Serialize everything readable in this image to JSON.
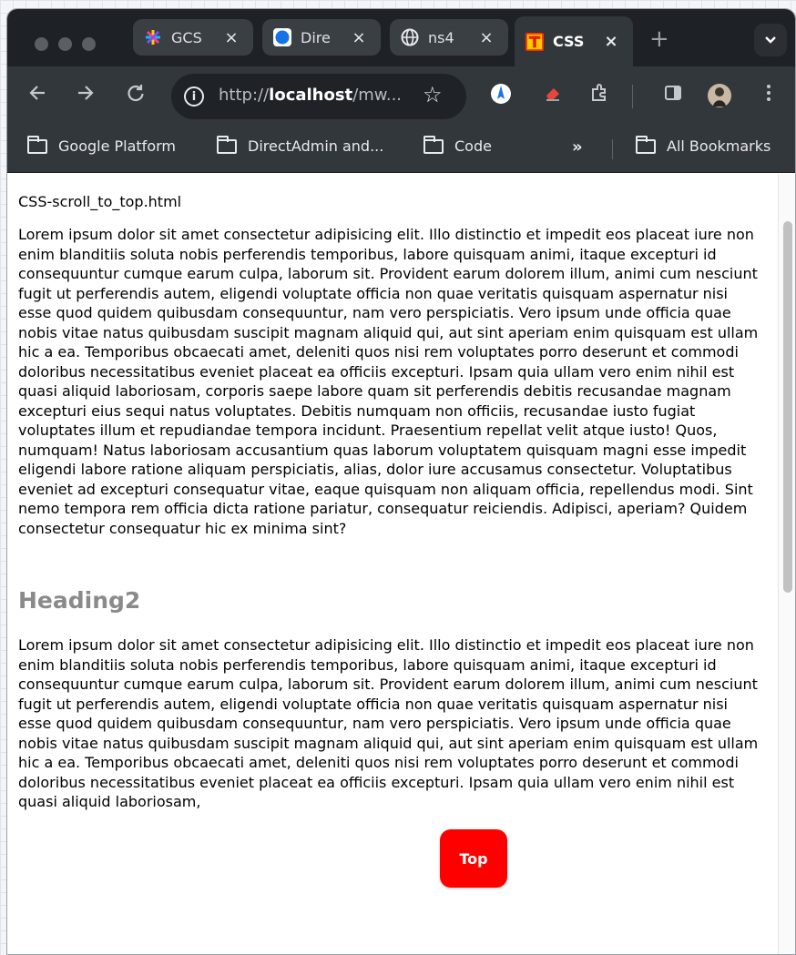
{
  "tabs": [
    {
      "title": "GCS",
      "favicon": "colorful-star-icon"
    },
    {
      "title": "Dire",
      "favicon": "blue-circle-icon"
    },
    {
      "title": "ns4",
      "favicon": "globe-icon"
    },
    {
      "title": "CSS",
      "favicon": "t-letter-icon",
      "active": true
    }
  ],
  "tab_close": "×",
  "new_tab": "+",
  "tab_search": "⌄",
  "address": {
    "prefix": "http://",
    "host": "localhost",
    "path": "/mw..."
  },
  "toolbar_icons": [
    "back-icon",
    "forward-icon",
    "reload-icon",
    "info-icon",
    "star-icon",
    "extension-icon",
    "eraser-icon",
    "puzzle-icon",
    "sidebar-icon",
    "profile-icon",
    "menu-icon"
  ],
  "bookmarks": [
    {
      "label": "Google Platform"
    },
    {
      "label": "DirectAdmin and..."
    },
    {
      "label": "Code"
    }
  ],
  "bookmarks_overflow": "»",
  "all_bookmarks": "All Bookmarks",
  "page": {
    "filename": "CSS-scroll_to_top.html",
    "paragraph1": "Lorem ipsum dolor sit amet consectetur adipisicing elit. Illo distinctio et impedit eos placeat iure non enim blanditiis soluta nobis perferendis temporibus, labore quisquam animi, itaque excepturi id consequuntur cumque earum culpa, laborum sit. Provident earum dolorem illum, animi cum nesciunt fugit ut perferendis autem, eligendi voluptate officia non quae veritatis quisquam aspernatur nisi esse quod quidem quibusdam consequuntur, nam vero perspiciatis. Vero ipsum unde officia quae nobis vitae natus quibusdam suscipit magnam aliquid qui, aut sint aperiam enim quisquam est ullam hic a ea. Temporibus obcaecati amet, deleniti quos nisi rem voluptates porro deserunt et commodi doloribus necessitatibus eveniet placeat ea officiis excepturi. Ipsam quia ullam vero enim nihil est quasi aliquid laboriosam, corporis saepe labore quam sit perferendis debitis recusandae magnam excepturi eius sequi natus voluptates. Debitis numquam non officiis, recusandae iusto fugiat voluptates illum et repudiandae tempora incidunt. Praesentium repellat velit atque iusto! Quos, numquam! Natus laboriosam accusantium quas laborum voluptatem quisquam magni esse impedit eligendi labore ratione aliquam perspiciatis, alias, dolor iure accusamus consectetur. Voluptatibus eveniet ad excepturi consequatur vitae, eaque quisquam non aliquam officia, repellendus modi. Sint nemo tempora rem officia dicta ratione pariatur, consequatur reiciendis. Adipisci, aperiam? Quidem consectetur consequatur hic ex minima sint?",
    "heading2": "Heading2",
    "paragraph2": "Lorem ipsum dolor sit amet consectetur adipisicing elit. Illo distinctio et impedit eos placeat iure non enim blanditiis soluta nobis perferendis temporibus, labore quisquam animi, itaque excepturi id consequuntur cumque earum culpa, laborum sit. Provident earum dolorem illum, animi cum nesciunt fugit ut perferendis autem, eligendi voluptate officia non quae veritatis quisquam aspernatur nisi esse quod quidem quibusdam consequuntur, nam vero perspiciatis. Vero ipsum unde officia quae nobis vitae natus quibusdam suscipit magnam aliquid qui, aut sint aperiam enim quisquam est ullam hic a ea. Temporibus obcaecati amet, deleniti quos nisi rem voluptates porro deserunt et commodi doloribus necessitatibus eveniet placeat ea officiis excepturi. Ipsam quia ullam vero enim nihil est quasi aliquid laboriosam,",
    "top_button": "Top"
  },
  "colors": {
    "top_button": "#ff0000",
    "heading2": "#8a8a8a",
    "chrome_dark": "#32373c"
  }
}
